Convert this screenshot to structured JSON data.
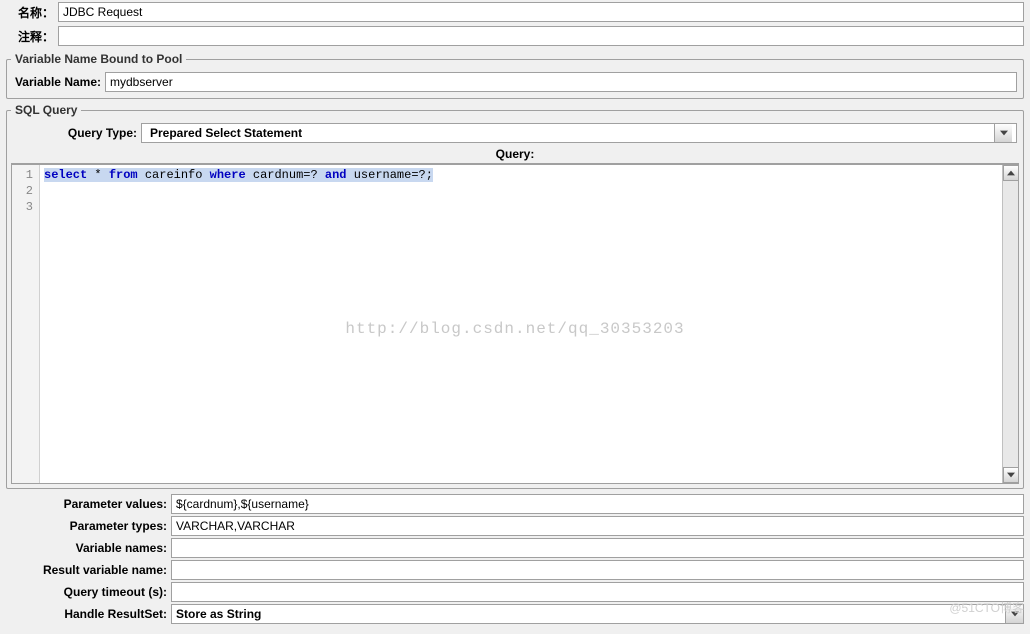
{
  "header": {
    "name_label": "名称：",
    "name_value": "JDBC Request",
    "comment_label": "注释：",
    "comment_value": ""
  },
  "variable_pool": {
    "legend": "Variable Name Bound to Pool",
    "label": "Variable Name:",
    "value": "mydbserver"
  },
  "sql_query": {
    "legend": "SQL Query",
    "query_type_label": "Query Type:",
    "query_type_value": "Prepared Select Statement",
    "query_label": "Query:",
    "query_lines": [
      "select * from careinfo where cardnum=? and username=?;",
      "",
      ""
    ],
    "line_numbers": [
      "1",
      "2",
      "3"
    ]
  },
  "params": {
    "param_values_label": "Parameter values:",
    "param_values": "${cardnum},${username}",
    "param_types_label": "Parameter types:",
    "param_types": "VARCHAR,VARCHAR",
    "variable_names_label": "Variable names:",
    "variable_names": "",
    "result_var_label": "Result variable name:",
    "result_var": "",
    "query_timeout_label": "Query timeout (s):",
    "query_timeout": "",
    "handle_resultset_label": "Handle ResultSet:",
    "handle_resultset": "Store as String"
  },
  "watermark": "http://blog.csdn.net/qq_30353203",
  "watermark2": "@51CTO博客"
}
